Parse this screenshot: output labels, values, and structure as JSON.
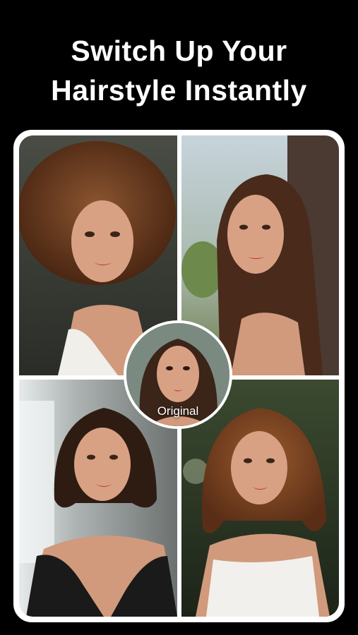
{
  "headline": {
    "line1": "Switch Up Your",
    "line2": "Hairstyle Instantly"
  },
  "styles": [
    {
      "name": "afro-curls",
      "hair_color": "#6e3f20",
      "bg_color": "#3a3d36"
    },
    {
      "name": "long-straight",
      "hair_color": "#4a2a1a",
      "bg_color": "#b8c6d0"
    },
    {
      "name": "short-bob",
      "hair_color": "#2e1c12",
      "bg_color": "#c9ced0"
    },
    {
      "name": "wavy-shoulder",
      "hair_color": "#7a4424",
      "bg_color": "#2c3a26"
    }
  ],
  "original": {
    "label": "Original",
    "hair_color": "#3b2418",
    "bg_color": "#7b8a80"
  },
  "colors": {
    "background": "#000000",
    "frame": "#ffffff",
    "skin": "#d9a184"
  }
}
